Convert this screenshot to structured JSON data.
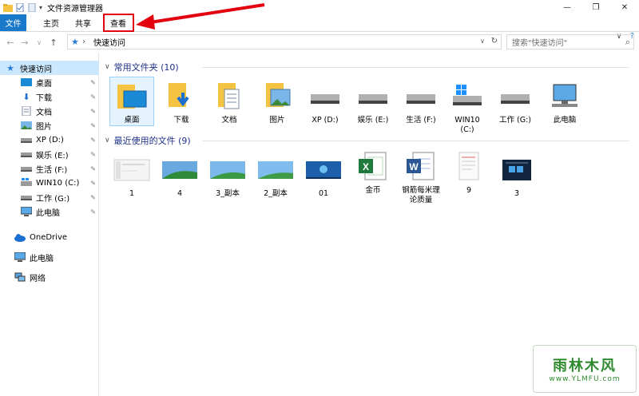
{
  "window": {
    "title": "文件资源管理器",
    "buttons": {
      "minimize": "—",
      "maximize": "❐",
      "close": "✕"
    }
  },
  "ribbon": {
    "tabs": [
      {
        "label": "文件"
      },
      {
        "label": "主页"
      },
      {
        "label": "共享"
      },
      {
        "label": "查看"
      }
    ],
    "right_expand": "∨",
    "right_help": "?"
  },
  "address": {
    "back": "←",
    "forward": "→",
    "recent": "∨",
    "up": "↑",
    "star": "★",
    "crumb_sep": "›",
    "path": "快速访问",
    "dropdown": "∨",
    "refresh": "↻"
  },
  "search": {
    "placeholder": "搜索\"快速访问\"",
    "icon": "⌕"
  },
  "sidebar": {
    "items": [
      {
        "label": "快速访问",
        "icon": "star-icon",
        "pinned": false,
        "selected": true
      },
      {
        "label": "桌面",
        "icon": "desktop-icon",
        "pinned": true
      },
      {
        "label": "下载",
        "icon": "download-icon",
        "pinned": true
      },
      {
        "label": "文档",
        "icon": "document-icon",
        "pinned": true
      },
      {
        "label": "图片",
        "icon": "pictures-icon",
        "pinned": true
      },
      {
        "label": "XP (D:)",
        "icon": "drive-icon",
        "pinned": true
      },
      {
        "label": "娱乐 (E:)",
        "icon": "drive-icon",
        "pinned": true
      },
      {
        "label": "生活 (F:)",
        "icon": "drive-icon",
        "pinned": true
      },
      {
        "label": "WIN10 (C:)",
        "icon": "windows-drive-icon",
        "pinned": true
      },
      {
        "label": "工作 (G:)",
        "icon": "drive-icon",
        "pinned": true
      },
      {
        "label": "此电脑",
        "icon": "computer-icon",
        "pinned": true
      }
    ],
    "onedrive": "OneDrive",
    "thispc": "此电脑",
    "network": "网络",
    "pin_glyph": "📌"
  },
  "main": {
    "frequent_header": "常用文件夹 (10)",
    "frequent": [
      {
        "label": "桌面",
        "icon": "folder-desktop-icon"
      },
      {
        "label": "下载",
        "icon": "folder-download-icon"
      },
      {
        "label": "文档",
        "icon": "folder-document-icon"
      },
      {
        "label": "图片",
        "icon": "folder-pictures-icon"
      },
      {
        "label": "XP (D:)",
        "icon": "drive-icon"
      },
      {
        "label": "娱乐 (E:)",
        "icon": "drive-icon"
      },
      {
        "label": "生活 (F:)",
        "icon": "drive-icon"
      },
      {
        "label": "WIN10\n(C:)",
        "icon": "windows-drive-icon"
      },
      {
        "label": "工作 (G:)",
        "icon": "drive-icon"
      },
      {
        "label": "此电脑",
        "icon": "computer-icon"
      }
    ],
    "recent_header": "最近使用的文件 (9)",
    "recent": [
      {
        "label": "1",
        "icon": "screenshot-thumbnail-icon"
      },
      {
        "label": "4",
        "icon": "landscape-thumbnail-icon"
      },
      {
        "label": "3_副本",
        "icon": "landscape-thumbnail-icon"
      },
      {
        "label": "2_副本",
        "icon": "landscape-thumbnail-icon"
      },
      {
        "label": "01",
        "icon": "win7-thumbnail-icon"
      },
      {
        "label": "金币",
        "icon": "excel-file-icon"
      },
      {
        "label": "钢筋每米理\n论质量",
        "icon": "word-file-icon"
      },
      {
        "label": "9",
        "icon": "document-thumbnail-icon"
      },
      {
        "label": "3",
        "icon": "dark-screen-thumbnail-icon"
      }
    ]
  },
  "watermark": {
    "main": "雨林木风",
    "sub": "www.YLMFU.com"
  },
  "colors": {
    "accent": "#1979ca",
    "highlight": "#e3000f",
    "folder": "#f5c342",
    "header_text": "#1e3287"
  }
}
